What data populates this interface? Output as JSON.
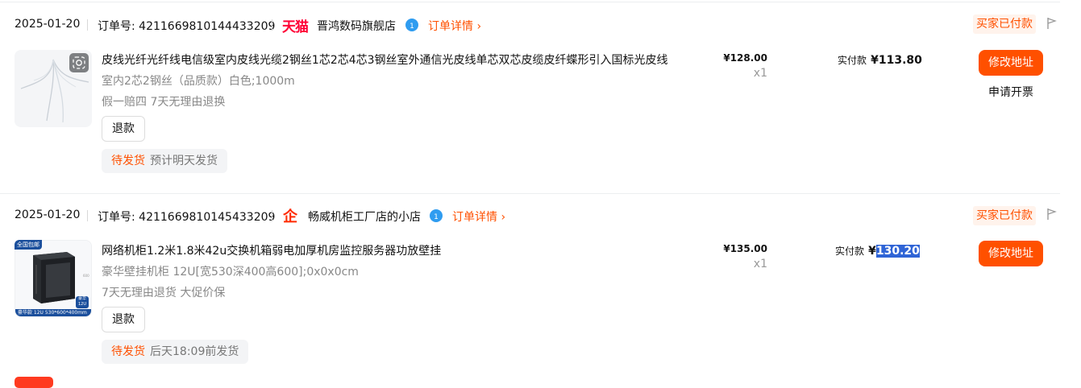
{
  "orders": [
    {
      "date": "2025-01-20",
      "order_label": "订单号:",
      "order_no": "4211669810144433209",
      "platform_logo_text": "天猫",
      "shop_name": "晋鸿数码旗舰店",
      "detail_link": "订单详情 ›",
      "status": "买家已付款",
      "item": {
        "title": "皮线光纤光纤线电信级室内皮线光缆2钢丝1芯2芯4芯3钢丝室外通信光皮线单芯双芯皮缆皮纤蝶形引入国标光皮线",
        "sku": "室内2芯2钢丝（品质款）白色;1000m",
        "promise": "假一赔四 7天无理由退换",
        "refund_button": "退款",
        "ship_status": "待发货",
        "ship_eta": "预计明天发货",
        "price": "¥128.00",
        "quantity": "x1"
      },
      "paid_label": "实付款",
      "paid_currency": "¥",
      "paid_amount": "113.80",
      "primary_action": "修改地址",
      "secondary_action": "申请开票"
    },
    {
      "date": "2025-01-20",
      "order_label": "订单号:",
      "order_no": "4211669810145433209",
      "platform_logo_text": "企",
      "shop_name": "畅威机柜工厂店的小店",
      "detail_link": "订单详情 ›",
      "status": "买家已付款",
      "item": {
        "title": "网络机柜1.2米1.8米42u交换机箱弱电加厚机房监控服务器功放壁挂",
        "sku": "豪华壁挂机柜 12U[宽530深400高600];0x0x0cm",
        "promise": "7天无理由退货 大促价保",
        "refund_button": "退款",
        "ship_status": "待发货",
        "ship_eta": "后天18:09前发货",
        "price": "¥135.00",
        "quantity": "x1",
        "thumb_badge": "全国包邮",
        "thumb_caption": "豪华款 12U 530*600*400mm",
        "thumb_corner": "豪华 12U"
      },
      "paid_label": "实付款",
      "paid_currency": "¥",
      "paid_amount": "130.20",
      "primary_action": "修改地址"
    }
  ]
}
